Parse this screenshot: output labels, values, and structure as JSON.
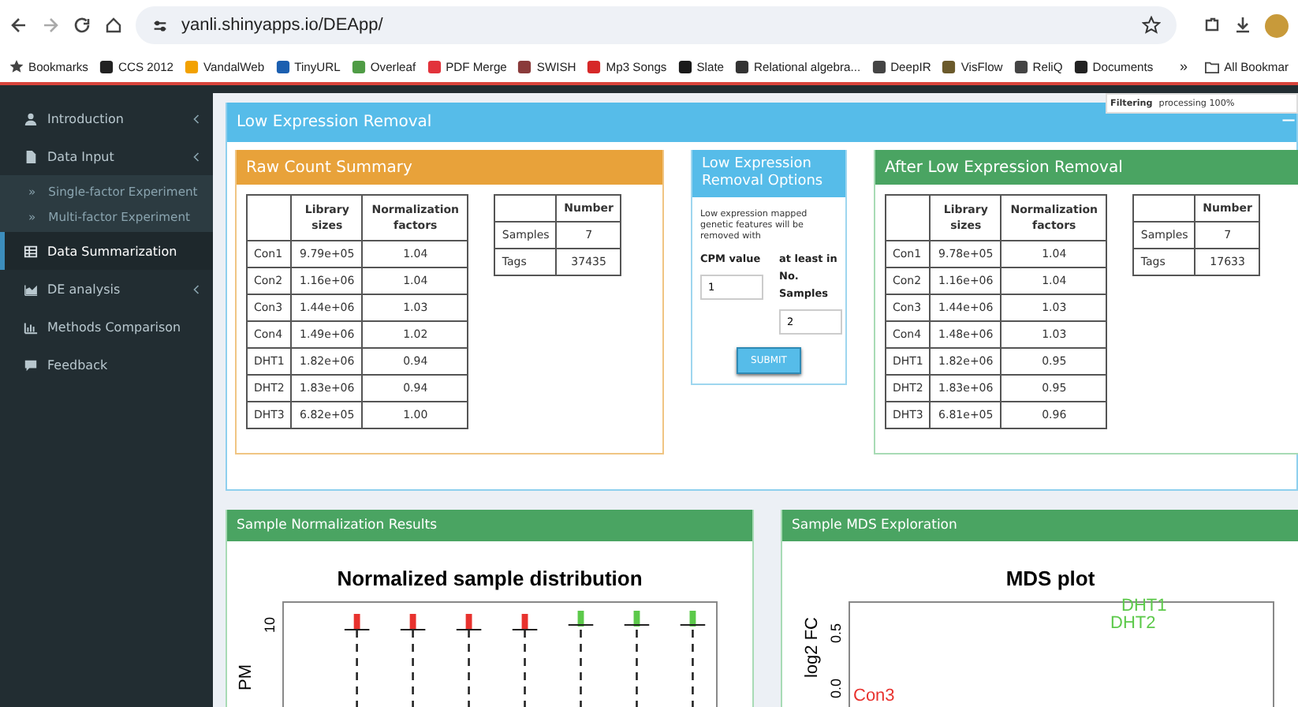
{
  "browser": {
    "url": "yanli.shinyapps.io/DEApp/",
    "bookmarks_label": "Bookmarks",
    "bookmarks": [
      {
        "label": "CCS 2012",
        "color": "#222222"
      },
      {
        "label": "VandalWeb",
        "color": "#f2a100"
      },
      {
        "label": "TinyURL",
        "color": "#1b5fb0"
      },
      {
        "label": "Overleaf",
        "color": "#4f9c45"
      },
      {
        "label": "PDF Merge",
        "color": "#e2333b"
      },
      {
        "label": "SWISH",
        "color": "#8a3b3b"
      },
      {
        "label": "Mp3 Songs",
        "color": "#d62828"
      },
      {
        "label": "Slate",
        "color": "#1a1a1a"
      },
      {
        "label": "Relational algebra...",
        "color": "#333333"
      },
      {
        "label": "DeepIR",
        "color": "#444444"
      },
      {
        "label": "VisFlow",
        "color": "#6b5a2b"
      },
      {
        "label": "ReliQ",
        "color": "#444444"
      },
      {
        "label": "Documents",
        "color": "#222222"
      }
    ],
    "more": "»",
    "all_bookmarks": "All Bookmar"
  },
  "sidebar": {
    "items": [
      {
        "label": "Introduction",
        "kind": "user",
        "has_caret": true,
        "selected": false
      },
      {
        "label": "Data Input",
        "kind": "file",
        "has_caret": true,
        "selected": false,
        "children": [
          {
            "label": "Single-factor Experiment",
            "marker": "»"
          },
          {
            "label": "Multi-factor Experiment",
            "marker": "»"
          }
        ]
      },
      {
        "label": "Data Summarization",
        "kind": "table",
        "has_caret": false,
        "selected": true
      },
      {
        "label": "DE analysis",
        "kind": "area",
        "has_caret": true,
        "selected": false
      },
      {
        "label": "Methods Comparison",
        "kind": "bars",
        "has_caret": false,
        "selected": false
      },
      {
        "label": "Feedback",
        "kind": "comment",
        "has_caret": false,
        "selected": false
      }
    ]
  },
  "notification": {
    "title": "Filtering",
    "message": "processing 100%"
  },
  "main_box": {
    "title": "Low Expression Removal",
    "collapse": "−"
  },
  "raw_summary": {
    "title": "Raw Count Summary",
    "columns": [
      "",
      "Library sizes",
      "Normalization factors"
    ],
    "rows": [
      [
        "Con1",
        "9.79e+05",
        "1.04"
      ],
      [
        "Con2",
        "1.16e+06",
        "1.04"
      ],
      [
        "Con3",
        "1.44e+06",
        "1.03"
      ],
      [
        "Con4",
        "1.49e+06",
        "1.02"
      ],
      [
        "DHT1",
        "1.82e+06",
        "0.94"
      ],
      [
        "DHT2",
        "1.83e+06",
        "0.94"
      ],
      [
        "DHT3",
        "6.82e+05",
        "1.00"
      ]
    ],
    "count_columns": [
      "",
      "Number"
    ],
    "counts": [
      [
        "Samples",
        "7"
      ],
      [
        "Tags",
        "37435"
      ]
    ]
  },
  "options": {
    "title": "Low Expression Removal Options",
    "description": "Low expression mapped genetic features will be removed with",
    "cpm_label": "CPM value",
    "cpm_value": "1",
    "samples_label": "at least in No. Samples",
    "samples_value": "2",
    "submit": "SUBMIT"
  },
  "after_summary": {
    "title": "After Low Expression Removal",
    "columns": [
      "",
      "Library sizes",
      "Normalization factors"
    ],
    "rows": [
      [
        "Con1",
        "9.78e+05",
        "1.04"
      ],
      [
        "Con2",
        "1.16e+06",
        "1.04"
      ],
      [
        "Con3",
        "1.44e+06",
        "1.03"
      ],
      [
        "Con4",
        "1.48e+06",
        "1.03"
      ],
      [
        "DHT1",
        "1.82e+06",
        "0.95"
      ],
      [
        "DHT2",
        "1.83e+06",
        "0.95"
      ],
      [
        "DHT3",
        "6.81e+05",
        "0.96"
      ]
    ],
    "count_columns": [
      "",
      "Number"
    ],
    "counts": [
      [
        "Samples",
        "7"
      ],
      [
        "Tags",
        "17633"
      ]
    ]
  },
  "normalization": {
    "title": "Sample Normalization Results",
    "plot_title": "Normalized sample distribution",
    "ylabel": "PM",
    "ytick": "10",
    "boxes": [
      {
        "color": "#e8322e"
      },
      {
        "color": "#e8322e"
      },
      {
        "color": "#e8322e"
      },
      {
        "color": "#e8322e"
      },
      {
        "color": "#5cc94a"
      },
      {
        "color": "#5cc94a"
      },
      {
        "color": "#5cc94a"
      }
    ]
  },
  "mds": {
    "title": "Sample MDS Exploration",
    "plot_title": "MDS plot",
    "ylabel": "log2 FC",
    "yticks": [
      "0.5",
      "0.0"
    ],
    "points": [
      {
        "label": "DHT1",
        "color": "#5cc94a"
      },
      {
        "label": "DHT2",
        "color": "#5cc94a"
      },
      {
        "label": "Con3",
        "color": "#e8322e"
      }
    ]
  }
}
